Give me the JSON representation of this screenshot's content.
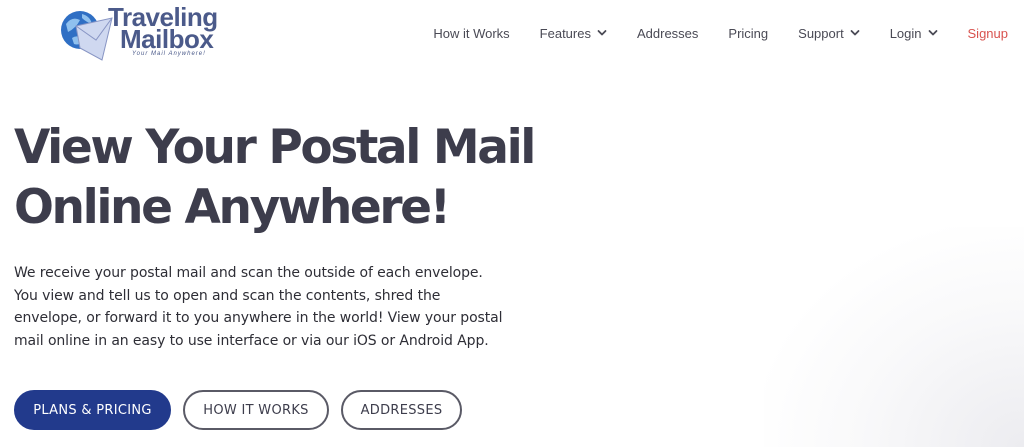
{
  "brand": {
    "name_line1": "Traveling",
    "name_line2": "Mailbox",
    "tagline": "Your Mail Anywhere!",
    "colors": {
      "logo": "#4b5a8a",
      "globe": "#2f6fc4",
      "envelope": "#cfd8f0"
    }
  },
  "nav": {
    "items": [
      {
        "label": "How it Works",
        "dropdown": false
      },
      {
        "label": "Features",
        "dropdown": true
      },
      {
        "label": "Addresses",
        "dropdown": false
      },
      {
        "label": "Pricing",
        "dropdown": false
      },
      {
        "label": "Support",
        "dropdown": true
      },
      {
        "label": "Login",
        "dropdown": true
      }
    ],
    "signup_label": "Signup",
    "signup_color": "#d9534f",
    "chevron_icon": "chevron-down-icon"
  },
  "hero": {
    "title_lines": [
      "View Your Postal Mail",
      "Online Anywhere!"
    ],
    "description_lines": [
      "We receive your postal mail and scan the outside of each envelope.",
      "You view and tell us to open and scan the contents, shred the",
      "envelope, or forward it to you anywhere in the world! View your postal",
      "mail online in an easy to use interface or via our iOS or Android App."
    ]
  },
  "buttons": {
    "plans_pricing": "PLANS & PRICING",
    "how_it_works": "HOW IT WORKS",
    "addresses": "ADDRESSES",
    "primary_color": "#223a8c"
  }
}
